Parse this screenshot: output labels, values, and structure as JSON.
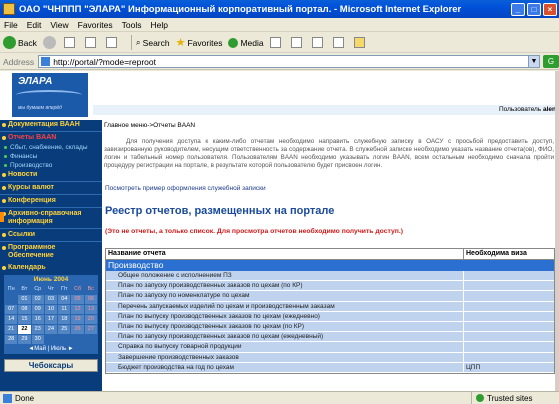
{
  "window": {
    "title": "ОАО \"ЧНППП \"ЭЛАРА\" Информационный корпоративный портал. - Microsoft Internet Explorer",
    "minimize": "_",
    "maximize": "□",
    "close": "×"
  },
  "menu": [
    "File",
    "Edit",
    "View",
    "Favorites",
    "Tools",
    "Help"
  ],
  "toolbar": {
    "back": "Back",
    "search": "Search",
    "favorites": "Favorites",
    "media": "Media"
  },
  "address": {
    "label": "Address",
    "url": "http://portal/?mode=reproot",
    "go": "G"
  },
  "portal": {
    "logo": "ЭЛАРА",
    "slogan": "мы думаем вперёд",
    "user_label": "Пользователь",
    "user_name": "alen"
  },
  "nav": {
    "items": [
      {
        "label": "Документация ВААН",
        "style": "item"
      },
      {
        "label": "Отчеты BAAN",
        "style": "red"
      },
      {
        "label": "Сбыт, снабжение, склады",
        "style": "sub"
      },
      {
        "label": "Финансы",
        "style": "sub"
      },
      {
        "label": "Производство",
        "style": "sub"
      },
      {
        "label": "Новости",
        "style": "item"
      },
      {
        "label": "Курсы валют",
        "style": "item"
      },
      {
        "label": "Конференция",
        "style": "item"
      },
      {
        "label": "Архивно-справочная информация",
        "style": "two"
      },
      {
        "label": "Ссылки",
        "style": "item"
      },
      {
        "label": "Программное Обеспечение",
        "style": "two"
      }
    ]
  },
  "calendar": {
    "title": "Календарь",
    "month": "Июнь 2004",
    "days": [
      "Пн",
      "Вт",
      "Ср",
      "Чт",
      "Пт",
      "Сб",
      "Вс"
    ],
    "cells": [
      "",
      "01",
      "02",
      "03",
      "04",
      "05",
      "06",
      "07",
      "08",
      "09",
      "10",
      "11",
      "12",
      "13",
      "14",
      "15",
      "16",
      "17",
      "18",
      "19",
      "20",
      "21",
      "22",
      "23",
      "24",
      "25",
      "26",
      "27",
      "28",
      "29",
      "30",
      "",
      "",
      "",
      ""
    ],
    "today": "22",
    "nav": "◄Май | Июль ►",
    "board": "Чебоксары"
  },
  "main": {
    "breadcrumb": "Главное меню->Отчеты BAAN",
    "intro": "Для получения доступа к каким-либо отчетам необходимо направить служебную записку в ОАСУ с просьбой предоставить доступ, завизированную руководителем, несущим ответственность за содержание отчета. В служебной записке необходимо указать название отчета(ов), ФИО, логин и табельный номер пользователя. Пользователям BAAN необходимо указывать логин BAAN, всем остальным необходимо сначала пройти процедуру регистрации на портале, в результате которой пользователю будет присвоен логин.",
    "sample_link": "Посмотреть пример оформления служебной записки",
    "title": "Реестр отчетов, размещенных на портале",
    "warning": "(Это не отчеты, а только список. Для просмотра отчетов необходимо получить доступ.)"
  },
  "table": {
    "col_name": "Название отчета",
    "col_visa": "Необходима виза",
    "group": "Производство",
    "rows": [
      {
        "name": "Общее положение с исполнением ПЗ",
        "visa": ""
      },
      {
        "name": "План по запуску производственных заказов по цехам (по КР)",
        "visa": ""
      },
      {
        "name": "План по запуску по номенклатуре по цехам",
        "visa": ""
      },
      {
        "name": "Перечень запускаемых изделий по цехам и производственным заказам",
        "visa": ""
      },
      {
        "name": "План по выпуску производственных заказов по цехам (ежедневно)",
        "visa": ""
      },
      {
        "name": "План по выпуску производственных заказов по цехам (по КР)",
        "visa": ""
      },
      {
        "name": "План по запуску производственных заказов по цехам (ежедневный)",
        "visa": ""
      },
      {
        "name": "Справка по выпуску товарной продукции",
        "visa": ""
      },
      {
        "name": "Завершение производственных заказов",
        "visa": ""
      },
      {
        "name": "Бюджет производства на год по цехам",
        "visa": "ЦПП"
      }
    ]
  },
  "status": {
    "left": "Done",
    "zone": "Trusted sites"
  }
}
